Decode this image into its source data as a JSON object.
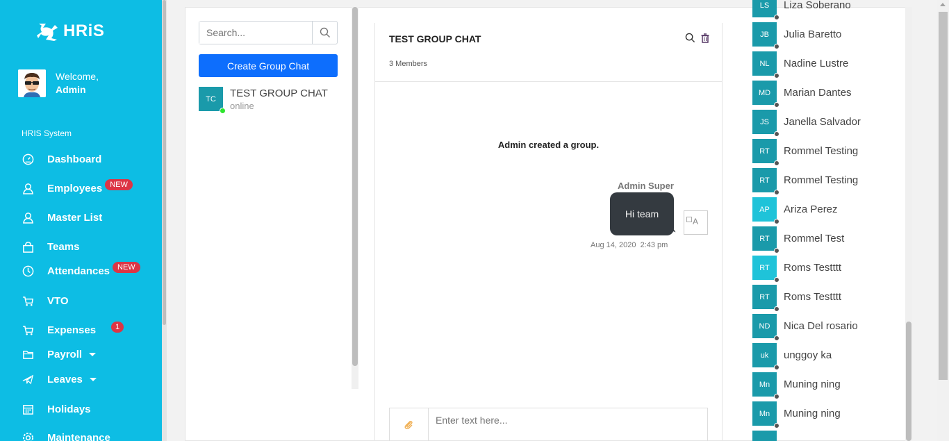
{
  "brand": {
    "name": "HRiS"
  },
  "user": {
    "greeting": "Welcome,",
    "name": "Admin"
  },
  "sidebar": {
    "section_label": "HRIS System",
    "items": [
      {
        "label": "Dashboard",
        "icon": "gauge-icon"
      },
      {
        "label": "Employees",
        "icon": "user-icon",
        "badge": "NEW"
      },
      {
        "label": "Master List",
        "icon": "user-icon"
      },
      {
        "label": "Teams",
        "icon": "bag-icon"
      },
      {
        "label": "Attendances",
        "icon": "clock-icon",
        "badge": "NEW"
      },
      {
        "label": "VTO",
        "icon": "cart-icon"
      },
      {
        "label": "Expenses",
        "icon": "cart-icon",
        "badge": "1"
      },
      {
        "label": "Payroll",
        "icon": "folder-icon"
      },
      {
        "label": "Leaves",
        "icon": "plane-icon"
      },
      {
        "label": "Holidays",
        "icon": "calendar-icon"
      },
      {
        "label": "Maintenance",
        "icon": "gear-icon"
      }
    ]
  },
  "chat_list": {
    "search_placeholder": "Search...",
    "create_button": "Create Group Chat",
    "chats": [
      {
        "initials": "TC",
        "name": "TEST GROUP CHAT",
        "status": "online"
      }
    ]
  },
  "chat": {
    "title": "TEST GROUP CHAT",
    "members_count": "3 Members",
    "system_message": "Admin created a group.",
    "messages": [
      {
        "sender": "Admin Super",
        "text": "Hi team",
        "date": "Aug 14, 2020",
        "time": "2:43 pm",
        "avatar_alt": "A"
      }
    ],
    "input_placeholder": "Enter text here..."
  },
  "members": [
    {
      "initials": "LS",
      "name": "Liza Soberano",
      "color": "#1a9aaa"
    },
    {
      "initials": "JB",
      "name": "Julia Baretto",
      "color": "#1a9aaa"
    },
    {
      "initials": "NL",
      "name": "Nadine Lustre",
      "color": "#1a9aaa"
    },
    {
      "initials": "MD",
      "name": "Marian Dantes",
      "color": "#1a9aaa"
    },
    {
      "initials": "JS",
      "name": "Janella Salvador",
      "color": "#1a9aaa"
    },
    {
      "initials": "RT",
      "name": "Rommel Testing",
      "color": "#1a9aaa"
    },
    {
      "initials": "RT",
      "name": "Rommel Testing",
      "color": "#1a9aaa"
    },
    {
      "initials": "AP",
      "name": "Ariza Perez",
      "color": "#1fc3d9"
    },
    {
      "initials": "RT",
      "name": "Rommel Test",
      "color": "#1a9aaa"
    },
    {
      "initials": "RT",
      "name": "Roms Testttt",
      "color": "#1fc3d9"
    },
    {
      "initials": "RT",
      "name": "Roms Testttt",
      "color": "#1a9aaa"
    },
    {
      "initials": "ND",
      "name": "Nica Del rosario",
      "color": "#1a9aaa"
    },
    {
      "initials": "uk",
      "name": "unggoy ka",
      "color": "#1a9aaa"
    },
    {
      "initials": "Mn",
      "name": "Muning ning",
      "color": "#1a9aaa"
    },
    {
      "initials": "Mn",
      "name": "Muning ning",
      "color": "#1a9aaa"
    },
    {
      "initials": "",
      "name": "",
      "color": "#1a9aaa"
    }
  ]
}
